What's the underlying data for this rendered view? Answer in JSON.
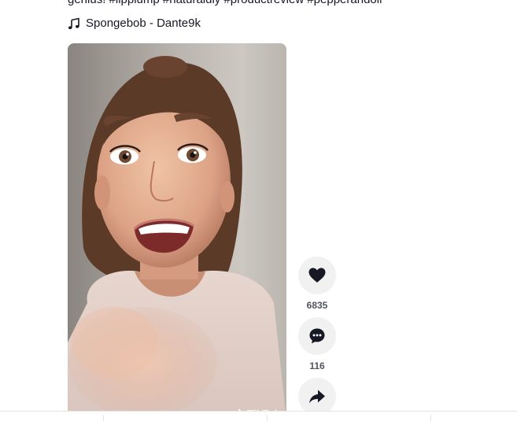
{
  "post": {
    "caption": "genius! #lipplump #naturaldiy #productreview #pepperandoil",
    "sound_label": "Spongebob - Dante9k",
    "music_icon": "music-note-icon"
  },
  "video": {
    "watermark": "TikTok"
  },
  "actions": {
    "like_count": "6835",
    "comment_count": "116",
    "like_icon": "heart-icon",
    "comment_icon": "comment-icon",
    "share_icon": "share-icon"
  }
}
